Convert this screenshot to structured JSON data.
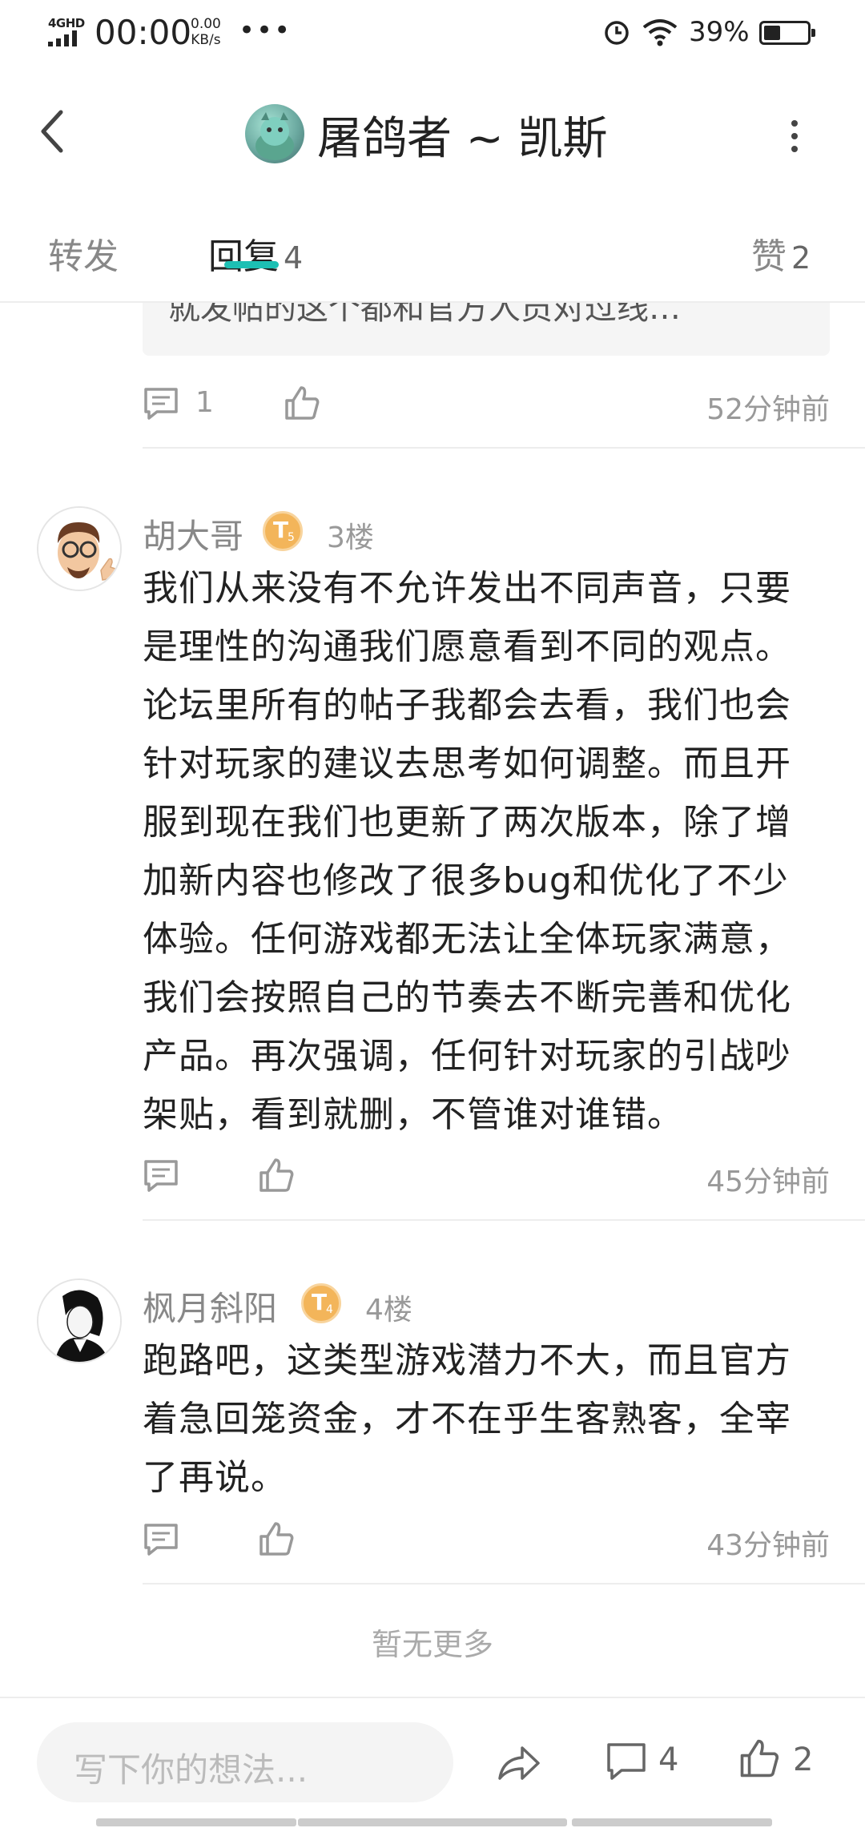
{
  "status_bar": {
    "network": "4GHD",
    "time": "00:00",
    "speed_value": "0.00",
    "speed_unit": "KB/s",
    "more": "•••",
    "battery_percent": "39%",
    "battery_level": 0.39
  },
  "header": {
    "title": "屠鸽者 ~ 凯斯"
  },
  "tabs": [
    {
      "label": "转发",
      "count": ""
    },
    {
      "label": "回复",
      "count": "4"
    },
    {
      "label": "赞",
      "count": "2"
    }
  ],
  "previous_reply": {
    "quote_text": "就发帖的这个都和官方人员对过线…",
    "comment_count": "1",
    "time": "52分钟前"
  },
  "posts": [
    {
      "username": "胡大哥",
      "level": "T",
      "level_num": "5",
      "floor": "3楼",
      "lines": [
        "我们从来没有不允许发出不同声音，只要",
        "是理性的沟通我们愿意看到不同的观点。",
        "论坛里所有的帖子我都会去看，我们也会",
        "针对玩家的建议去思考如何调整。而且开",
        "服到现在我们也更新了两次版本，除了增",
        "加新内容也修改了很多bug和优化了不少",
        "体验。任何游戏都无法让全体玩家满意，",
        "我们会按照自己的节奏去不断完善和优化",
        "产品。再次强调，任何针对玩家的引战吵",
        "架贴，看到就删，不管谁对谁错。"
      ],
      "time": "45分钟前"
    },
    {
      "username": "枫月斜阳",
      "level": "T",
      "level_num": "4",
      "floor": "4楼",
      "lines": [
        "跑路吧，这类型游戏潜力不大，而且官方",
        "着急回笼资金，才不在乎生客熟客，全宰",
        "了再说。"
      ],
      "time": "43分钟前"
    }
  ],
  "no_more": "暂无更多",
  "bottom_bar": {
    "input_placeholder": "写下你的想法...",
    "comment_count": "4",
    "like_count": "2"
  },
  "colors": {
    "accent": "#1dbfb3",
    "badge": "#f3b55a"
  }
}
